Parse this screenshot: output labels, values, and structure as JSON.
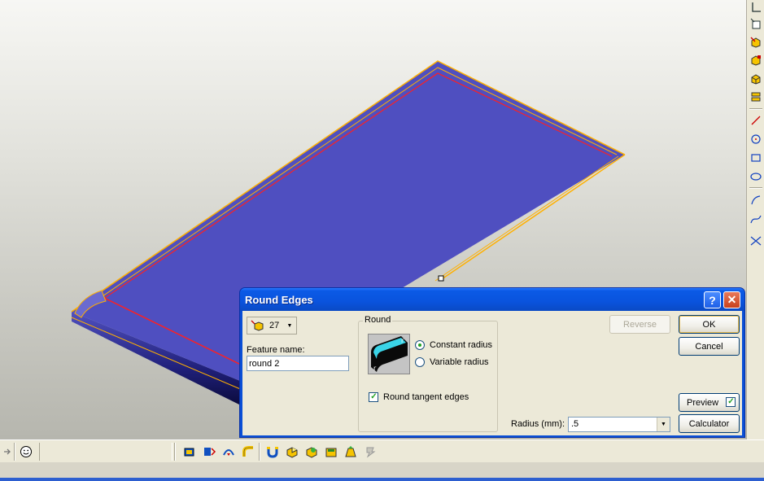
{
  "dialog": {
    "title": "Round Edges",
    "help_glyph": "?",
    "close_glyph": "✕",
    "feature_count": "27",
    "feature_name_label": "Feature name:",
    "feature_name_value": "round 2",
    "group_label": "Round",
    "radio_constant": "Constant radius",
    "radio_variable": "Variable radius",
    "selected_radius_type": "constant",
    "round_tangent_label": "Round tangent edges",
    "round_tangent_checked": true,
    "reverse_label": "Reverse",
    "ok_label": "OK",
    "cancel_label": "Cancel",
    "preview_label": "Preview",
    "preview_checked": true,
    "calculator_label": "Calculator",
    "radius_label": "Radius (mm):",
    "radius_value": ".5"
  },
  "colors": {
    "part_face": "#4f4fc0",
    "edge_highlight": "#ff2020",
    "edge_outline": "#ffb000",
    "titlebar": "#0a53dd"
  },
  "right_toolbar": {
    "icons": [
      "sketch-origin-icon",
      "sketch-plane-icon",
      "extrude-icon",
      "cut-icon",
      "shell-icon",
      "stack-icon",
      "line-icon",
      "circle-icon",
      "rectangle-icon",
      "ellipse-icon",
      "arc-icon",
      "spline-icon",
      "trim-icon"
    ]
  },
  "bottom_toolbar": {
    "icons": [
      "arrow-right-icon",
      "smiley-icon",
      "extrude-tool-icon",
      "revolve-tool-icon",
      "sweep-tool-icon",
      "pipe-tool-icon",
      "magnet-tool-icon",
      "shell-tool-icon",
      "round-tool-icon",
      "chamfer-tool-icon",
      "draft-tool-icon",
      "pattern-tool-icon"
    ]
  }
}
